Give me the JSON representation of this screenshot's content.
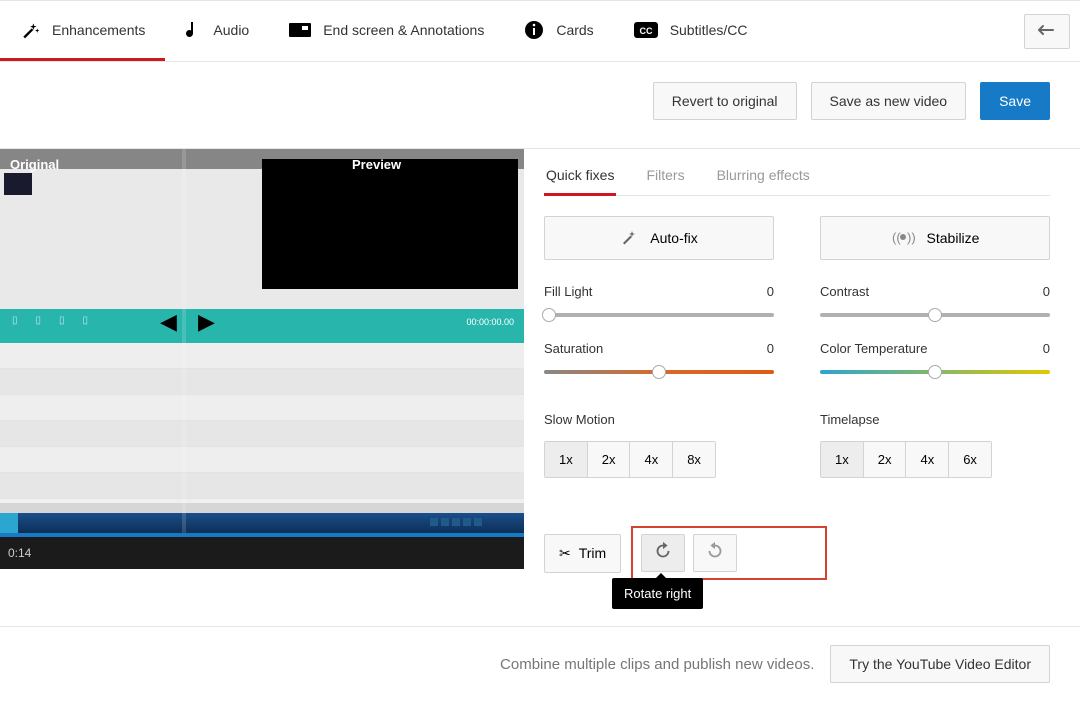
{
  "topTabs": {
    "enhancements": "Enhancements",
    "audio": "Audio",
    "endscreen": "End screen & Annotations",
    "cards": "Cards",
    "subtitles": "Subtitles/CC"
  },
  "actions": {
    "revert": "Revert to original",
    "saveNew": "Save as new video",
    "save": "Save"
  },
  "preview": {
    "originalLabel": "Original",
    "previewLabel": "Preview",
    "timecode": "0:14",
    "mockClock": "00:00:00.00"
  },
  "subtabs": {
    "quick": "Quick fixes",
    "filters": "Filters",
    "blur": "Blurring effects"
  },
  "wideButtons": {
    "autofix": "Auto-fix",
    "stabilize": "Stabilize"
  },
  "sliders": {
    "fillLight": {
      "label": "Fill Light",
      "value": "0",
      "pos": 2
    },
    "contrast": {
      "label": "Contrast",
      "value": "0",
      "pos": 50
    },
    "saturation": {
      "label": "Saturation",
      "value": "0",
      "pos": 50
    },
    "colorTemp": {
      "label": "Color Temperature",
      "value": "0",
      "pos": 50
    }
  },
  "speed": {
    "slowLabel": "Slow Motion",
    "lapseLabel": "Timelapse",
    "opts": [
      "1x",
      "2x",
      "4x",
      "6x"
    ],
    "slowOpts": [
      "1x",
      "2x",
      "4x",
      "8x"
    ]
  },
  "tools": {
    "trim": "Trim",
    "tooltip": "Rotate right"
  },
  "footer": {
    "text": "Combine multiple clips and publish new videos.",
    "cta": "Try the YouTube Video Editor"
  }
}
